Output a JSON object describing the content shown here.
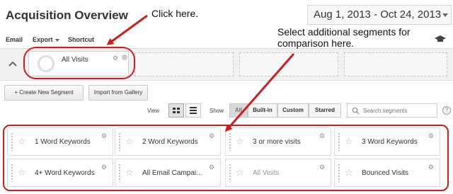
{
  "header": {
    "title": "Acquisition Overview",
    "date_range": "Aug 1, 2013 - Oct 24, 2013"
  },
  "toolbar": {
    "email_label": "Email",
    "export_label": "Export",
    "shortcut_label": "Shortcut",
    "cap_icon": "graduation-cap-icon"
  },
  "segments_bar": {
    "active_segment": "All Visits",
    "empty_slot_count": 3
  },
  "actions": {
    "create_label": "+ Create New Segment",
    "import_label": "Import from Gallery"
  },
  "filters": {
    "view_label": "View",
    "show_label": "Show",
    "show_options": [
      "All",
      "Built-in",
      "Custom",
      "Starred"
    ],
    "selected_show": "All",
    "search_placeholder": "Search segments",
    "help_label": "?"
  },
  "segments": [
    {
      "name": "1 Word Keywords",
      "selected": false
    },
    {
      "name": "2 Word Keywords",
      "selected": false
    },
    {
      "name": "3 or more visits",
      "selected": false
    },
    {
      "name": "3 Word Keywords",
      "selected": false
    },
    {
      "name": "4+ Word Keywords",
      "selected": false
    },
    {
      "name": "All Email Campai...",
      "selected": false
    },
    {
      "name": "All Visits",
      "selected": true
    },
    {
      "name": "Bounced Visits",
      "selected": false
    }
  ],
  "annotations": {
    "click_here": "Click here.",
    "select_line1": "Select additional segments for",
    "select_line2": "comparison here."
  },
  "colors": {
    "annotation_red": "#cc1e1e"
  }
}
